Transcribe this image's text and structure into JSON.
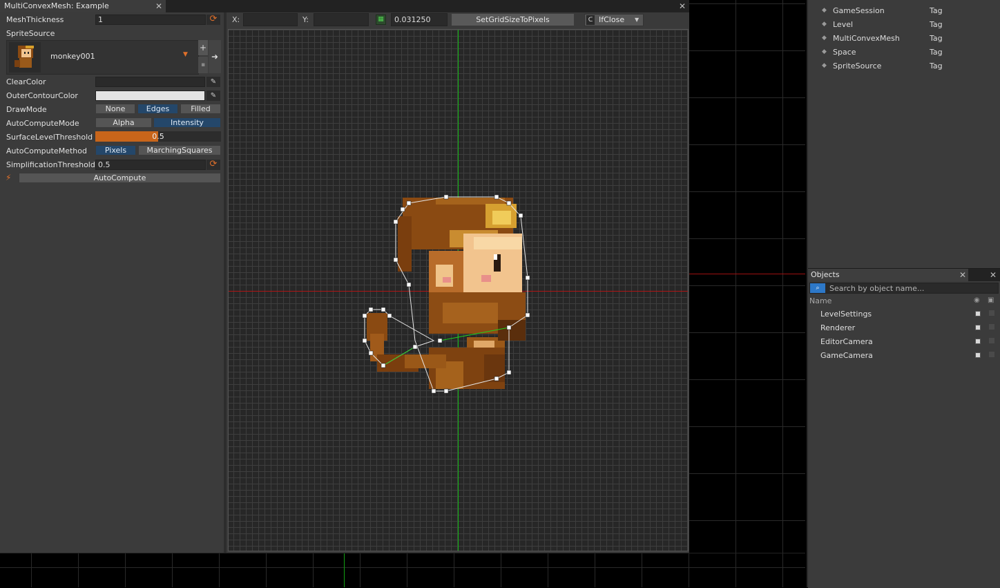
{
  "window": {
    "title": "MultiConvexMesh: Example"
  },
  "properties": {
    "mesh_thickness": {
      "label": "MeshThickness",
      "value": "1"
    },
    "sprite_source": {
      "label": "SpriteSource",
      "value": "monkey001"
    },
    "clear_color": {
      "label": "ClearColor",
      "color": "#2a2a2a"
    },
    "outer_contour_color": {
      "label": "OuterContourColor",
      "color": "#e3e3e3"
    },
    "draw_mode": {
      "label": "DrawMode",
      "options": [
        "None",
        "Edges",
        "Filled"
      ],
      "selected": "Edges"
    },
    "auto_compute_mode": {
      "label": "AutoComputeMode",
      "options": [
        "Alpha",
        "Intensity"
      ],
      "selected": "Intensity"
    },
    "surface_level_threshold": {
      "label": "SurfaceLevelThreshold",
      "value": "0.5",
      "fraction": 0.5
    },
    "auto_compute_method": {
      "label": "AutoComputeMethod",
      "options": [
        "Pixels",
        "MarchingSquares"
      ],
      "selected": "Pixels"
    },
    "simplification_threshold": {
      "label": "SimplificationThreshold",
      "value": "0.5"
    },
    "auto_compute_button": "AutoCompute"
  },
  "toolbar": {
    "x_label": "X:",
    "x_value": "",
    "y_label": "Y:",
    "y_value": "",
    "grid_size": "0.031250",
    "set_grid_button": "SetGridSizeToPixels",
    "snap_mode": "IfClose"
  },
  "right_panel": {
    "rows": [
      {
        "name": "GameSession",
        "type": "Tag"
      },
      {
        "name": "Level",
        "type": "Tag"
      },
      {
        "name": "MultiConvexMesh",
        "type": "Tag"
      },
      {
        "name": "Space",
        "type": "Tag"
      },
      {
        "name": "SpriteSource",
        "type": "Tag"
      }
    ]
  },
  "objects": {
    "title": "Objects",
    "search_placeholder": "Search by object name...",
    "column_name": "Name",
    "items": [
      "LevelSettings",
      "Renderer",
      "EditorCamera",
      "GameCamera"
    ]
  },
  "colors": {
    "accent_orange": "#c8651a",
    "selected_blue": "#24476a",
    "panel_bg": "#3b3b3b"
  }
}
